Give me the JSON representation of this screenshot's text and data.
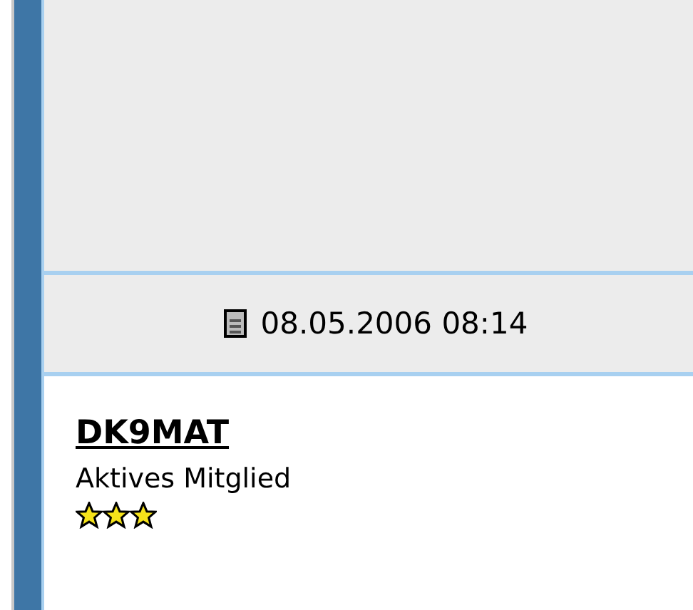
{
  "post": {
    "date": "08.05.2006 08:14"
  },
  "author": {
    "name": "DK9MAT",
    "rank": "Aktives Mitglied",
    "stars": 3
  }
}
